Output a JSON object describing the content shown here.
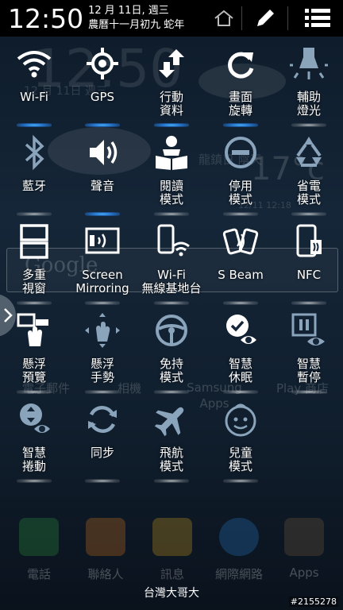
{
  "status": {
    "time": "12:50",
    "date_line": "12 月 11日, 週三",
    "lunar_line": "農曆十一月初九 蛇年"
  },
  "header_icons": [
    "home-icon",
    "edit-icon",
    "list-icon"
  ],
  "background": {
    "clock": "12:50",
    "date": "12 月 11日 週三",
    "weather": "龍鎮日 陰天",
    "temp": "17°c",
    "updated": "12/11 12:18",
    "search": "Google",
    "apps": [
      "電子郵件",
      "相機",
      "Samsung Apps",
      "Play 商店"
    ],
    "dock": [
      "電話",
      "聯絡人",
      "訊息",
      "網際網路",
      "Apps"
    ]
  },
  "accent": "#3aa8ff",
  "tiles": [
    {
      "label": "Wi-Fi",
      "icon": "wifi-icon",
      "on": true
    },
    {
      "label": "GPS",
      "icon": "gps-icon",
      "on": true
    },
    {
      "label": "行動\n資料",
      "icon": "mobile-data-icon",
      "on": true
    },
    {
      "label": "畫面\n旋轉",
      "icon": "rotate-icon",
      "on": true
    },
    {
      "label": "輔助\n燈光",
      "icon": "flashlight-icon",
      "on": false
    },
    {
      "label": "藍牙",
      "icon": "bluetooth-icon",
      "on": false
    },
    {
      "label": "聲音",
      "icon": "sound-icon",
      "on": true
    },
    {
      "label": "閱讀\n模式",
      "icon": "reading-mode-icon",
      "on": false
    },
    {
      "label": "停用\n模式",
      "icon": "blocking-mode-icon",
      "on": false
    },
    {
      "label": "省電\n模式",
      "icon": "power-saving-icon",
      "on": false
    },
    {
      "label": "多重\n視窗",
      "icon": "multi-window-icon",
      "on": false
    },
    {
      "label": "Screen\nMirroring",
      "icon": "screen-mirroring-icon",
      "on": false
    },
    {
      "label": "Wi-Fi\n無線基地台",
      "icon": "wifi-hotspot-icon",
      "on": false
    },
    {
      "label": "S Beam",
      "icon": "s-beam-icon",
      "on": false
    },
    {
      "label": "NFC",
      "icon": "nfc-icon",
      "on": false
    },
    {
      "label": "懸浮\n預覽",
      "icon": "air-view-icon",
      "on": false
    },
    {
      "label": "懸浮\n手勢",
      "icon": "air-gesture-icon",
      "on": false
    },
    {
      "label": "免持\n模式",
      "icon": "driving-mode-icon",
      "on": false
    },
    {
      "label": "智慧\n休眠",
      "icon": "smart-stay-icon",
      "on": false
    },
    {
      "label": "智慧\n暫停",
      "icon": "smart-pause-icon",
      "on": false
    },
    {
      "label": "智慧\n捲動",
      "icon": "smart-scroll-icon",
      "on": false
    },
    {
      "label": "同步",
      "icon": "sync-icon",
      "on": false
    },
    {
      "label": "飛航\n模式",
      "icon": "airplane-mode-icon",
      "on": false
    },
    {
      "label": "兒童\n模式",
      "icon": "kids-mode-icon",
      "on": false
    }
  ],
  "carrier": "台灣大哥大",
  "watermark": "#2155278"
}
